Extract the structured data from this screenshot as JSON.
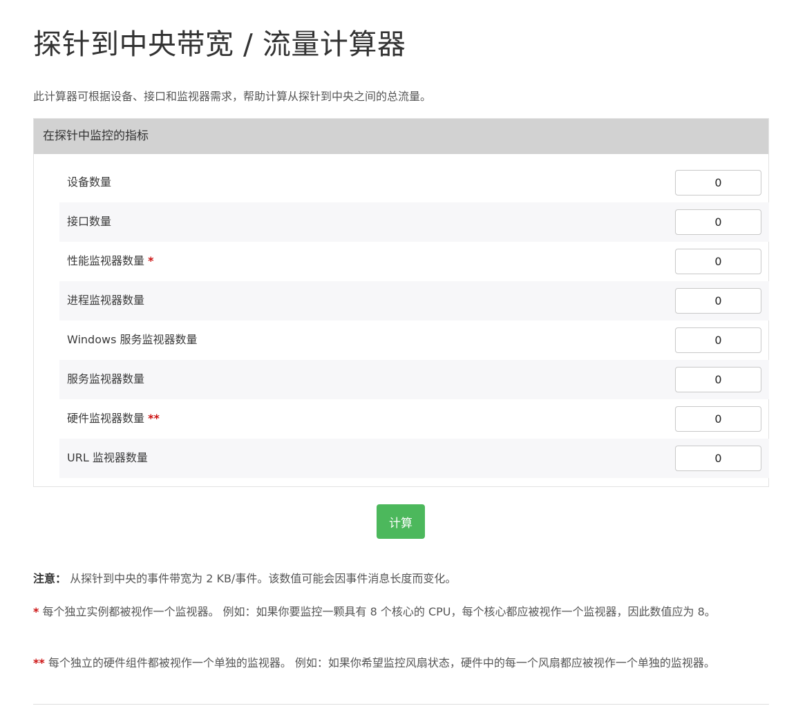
{
  "page": {
    "title": "探针到中央带宽 / 流量计算器",
    "intro": "此计算器可根据设备、接口和监视器需求，帮助计算从探针到中央之间的总流量。"
  },
  "panel": {
    "header": "在探针中监控的指标",
    "rows": [
      {
        "label": "设备数量",
        "marker": "",
        "value": "0"
      },
      {
        "label": "接口数量",
        "marker": "",
        "value": "0"
      },
      {
        "label": "性能监视器数量",
        "marker": "*",
        "value": "0"
      },
      {
        "label": "进程监视器数量",
        "marker": "",
        "value": "0"
      },
      {
        "label": "Windows 服务监视器数量",
        "marker": "",
        "value": "0"
      },
      {
        "label": "服务监视器数量",
        "marker": "",
        "value": "0"
      },
      {
        "label": "硬件监视器数量",
        "marker": "**",
        "value": "0"
      },
      {
        "label": "URL 监视器数量",
        "marker": "",
        "value": "0"
      }
    ]
  },
  "calculate_label": "计算",
  "notes": {
    "note_label": "注意：",
    "note_text": "从探针到中央的事件带宽为 2 KB/事件。该数值可能会因事件消息长度而变化。",
    "star1_marker": "*",
    "star1_text": " 每个独立实例都被视作一个监视器。 例如：如果你要监控一颗具有 8 个核心的 CPU，每个核心都应被视作一个监视器，因此数值应为 8。",
    "star2_marker": "**",
    "star2_text": " 每个独立的硬件组件都被视作一个单独的监视器。 例如：如果你希望监控风扇状态，硬件中的每一个风扇都应被视作一个单独的监视器。"
  },
  "colors": {
    "button": "#4cb85c",
    "header_bg": "#d2d2d2",
    "required": "#cc1111"
  }
}
